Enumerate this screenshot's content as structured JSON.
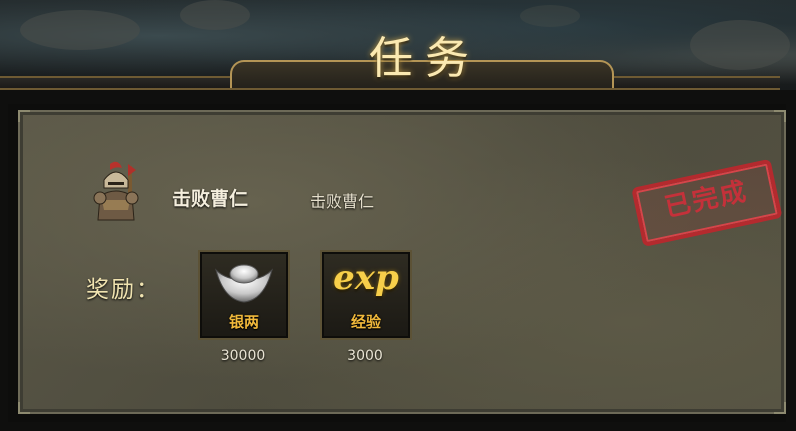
{
  "title": "任务",
  "quest": {
    "icon": "armored-warrior-icon",
    "name": "击败曹仁",
    "description": "击败曹仁"
  },
  "rewards": {
    "label": "奖励：",
    "items": [
      {
        "icon": "silver-ingot-icon",
        "name": "银两",
        "amount": "30000"
      },
      {
        "icon": "exp-icon",
        "symbol": "exp",
        "name": "经验",
        "amount": "3000"
      }
    ]
  },
  "status_stamp": "已完成",
  "colors": {
    "title_gold": "#fbe9b1",
    "panel_bg": "#55523f",
    "reward_name": "#f1b93b",
    "stamp_red": "#b42a2e"
  }
}
